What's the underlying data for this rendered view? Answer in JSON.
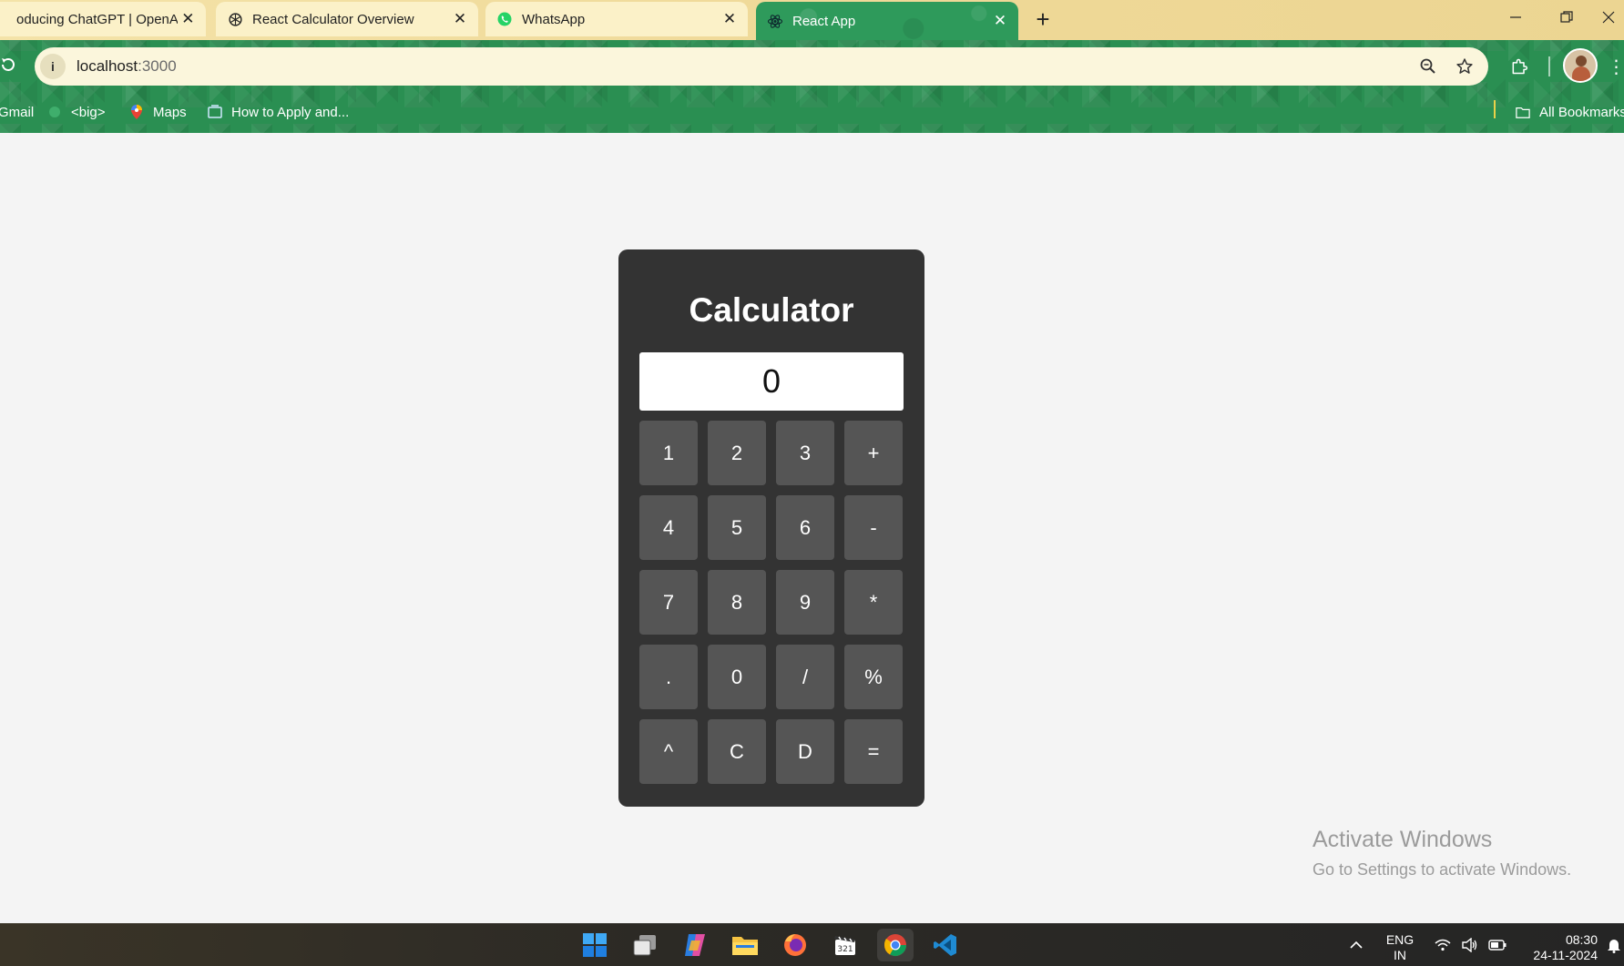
{
  "browser": {
    "tabs": [
      {
        "title": "oducing ChatGPT | OpenAI",
        "icon": "openai-icon"
      },
      {
        "title": "React Calculator Overview",
        "icon": "openai-icon"
      },
      {
        "title": "WhatsApp",
        "icon": "whatsapp-icon"
      },
      {
        "title": "React App",
        "icon": "react-icon",
        "active": true
      }
    ],
    "address": {
      "host": "localhost",
      "port": ":3000"
    },
    "bookmarks": [
      {
        "label": "Gmail",
        "icon": "gmail-icon"
      },
      {
        "label": "<big>",
        "icon": "globe-icon"
      },
      {
        "label": "Maps",
        "icon": "maps-icon"
      },
      {
        "label": "How to Apply and...",
        "icon": "page-icon"
      }
    ],
    "all_bookmarks_label": "All Bookmarks"
  },
  "calculator": {
    "title": "Calculator",
    "display": "0",
    "keys": [
      "1",
      "2",
      "3",
      "+",
      "4",
      "5",
      "6",
      "-",
      "7",
      "8",
      "9",
      "*",
      ".",
      "0",
      "/",
      "%",
      "^",
      "C",
      "D",
      "="
    ]
  },
  "watermark": {
    "line1": "Activate Windows",
    "line2": "Go to Settings to activate Windows."
  },
  "taskbar": {
    "apps": [
      "windows-start-icon",
      "task-view-icon",
      "copilot-icon",
      "file-explorer-icon",
      "firefox-icon",
      "clipchamp-icon",
      "chrome-icon",
      "vscode-icon"
    ],
    "language": {
      "line1": "ENG",
      "line2": "IN"
    },
    "time": "08:30",
    "date": "24-11-2024"
  },
  "colors": {
    "toolbar_green": "#2a8f52",
    "tabstrip_yellow": "#f4e3a8",
    "calculator_body": "#333333",
    "key": "#555555"
  }
}
